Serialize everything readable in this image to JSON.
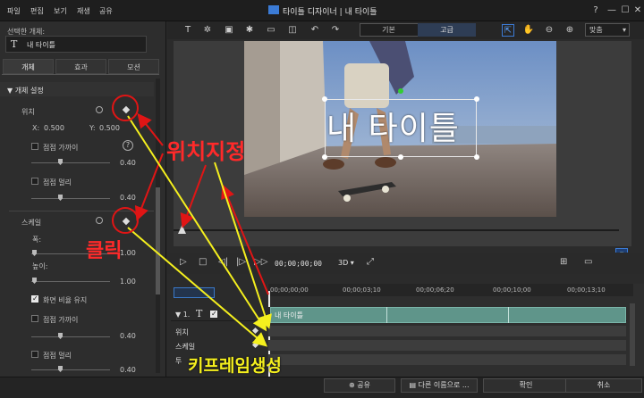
{
  "menu": [
    "파일",
    "편집",
    "보기",
    "재생",
    "공유"
  ],
  "window": {
    "title": "타이틀 디자이너  |  내 타이틀",
    "buttons": [
      "?",
      "—",
      "☐",
      "✕"
    ]
  },
  "left_panel": {
    "selected_label": "선택한 개체:",
    "selected_icon": "T",
    "selected_name": "내 타이틀",
    "tabs": [
      "개체",
      "효과",
      "모션"
    ],
    "section": "▼ 개체 설정",
    "position": {
      "label": "위치",
      "x_label": "X:",
      "x_value": "0.500",
      "y_label": "Y:",
      "y_value": "0.500",
      "ease_in_label": "점점 가까이",
      "ease_in_value": "0.40",
      "ease_out_label": "점점 멀리",
      "ease_out_value": "0.40"
    },
    "scale": {
      "label": "스케일",
      "width_label": "폭:",
      "width_value": "1.00",
      "height_label": "높이:",
      "height_value": "1.00",
      "keep_ratio_label": "화면 비율 유지",
      "ease_in_label": "점점 가까이",
      "ease_in_value": "0.40",
      "ease_out_label": "점점 멀리",
      "ease_out_value": "0.40"
    }
  },
  "toolbar": {
    "mode_basic": "기본",
    "mode_advanced": "고급",
    "zoom": "맞춤"
  },
  "canvas": {
    "title_text": "내 타이틀"
  },
  "player": {
    "timecode": "00;00;00;00",
    "dim": "3D ▾"
  },
  "timeline": {
    "ticks": [
      "00;00;00;00",
      "00;00;03;10",
      "00;00;06;20",
      "00;00;10;00",
      "00;00;13;10"
    ],
    "track_num": "▼ 1.",
    "track_icon": "T",
    "clip_label": "내 타이틀",
    "rows": [
      "위치",
      "스케일",
      "투"
    ]
  },
  "footer": {
    "share": "공유",
    "save_as": "다른 이름으로 ...",
    "ok": "확인",
    "cancel": "취소"
  },
  "annotations": {
    "position_label": "위치지정",
    "click_label": "클릭",
    "keyframe_label": "키프레임생성"
  },
  "colors": {
    "accent": "#3b7bd6",
    "clip": "#5f958a",
    "annotation_red": "#ff2a2a",
    "annotation_yellow": "#f5f01e"
  }
}
